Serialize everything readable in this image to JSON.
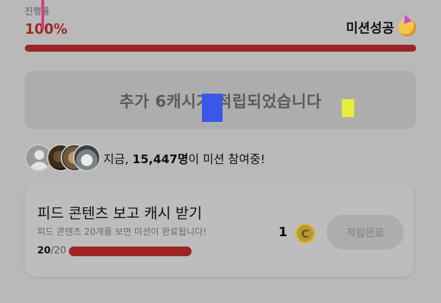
{
  "progress": {
    "caption": "진행률",
    "value": "100%",
    "status": "미션성공"
  },
  "reward_banner": {
    "text": "추가 6캐시가 적립되었습니다"
  },
  "participants": {
    "prefix": "지금, ",
    "count": "15,447명",
    "suffix": "이 미션 참여중!"
  },
  "mission": {
    "title": "피드 콘텐츠 보고 캐시 받기",
    "description": "피드 콘텐츠 20개를 보면 미션이 완료됩니다!",
    "count_current": "20",
    "count_total": "/20",
    "reward": "1",
    "coin_symbol": "C",
    "button_label": "적립완료",
    "progress_fraction": 1.0
  },
  "colors": {
    "accent": "#9d2525",
    "background": "#b9b9b9"
  }
}
